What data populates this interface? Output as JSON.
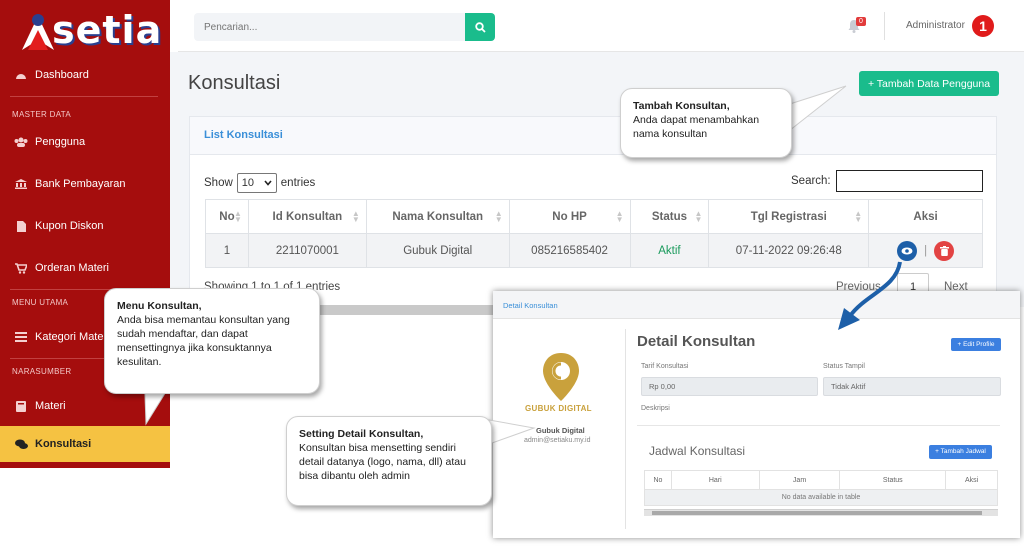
{
  "sidebar": {
    "logo_text": "setia",
    "items": [
      {
        "label": "Dashboard"
      },
      {
        "label": "Pengguna"
      },
      {
        "label": "Bank Pembayaran"
      },
      {
        "label": "Kupon Diskon"
      },
      {
        "label": "Orderan Materi"
      },
      {
        "label": "Kategori Materi"
      },
      {
        "label": "Materi"
      },
      {
        "label": "Konsultasi"
      }
    ],
    "sections": [
      "MASTER DATA",
      "MENU UTAMA",
      "NARASUMBER"
    ]
  },
  "topbar": {
    "search_placeholder": "Pencarian...",
    "notif_count": "0",
    "user_name": "Administrator",
    "avatar_letter": "1"
  },
  "main": {
    "page_title": "Konsultasi",
    "add_button": "+ Tambah Data Pengguna",
    "card_title": "List Konsultasi",
    "show_label": "Show",
    "show_value": "10",
    "entries_label": "entries",
    "search_label": "Search:",
    "table": {
      "headers": [
        "No",
        "Id Konsultan",
        "Nama Konsultan",
        "No HP",
        "Status",
        "Tgl Registrasi",
        "Aksi"
      ],
      "rows": [
        [
          "1",
          "2211070001",
          "Gubuk Digital",
          "085216585402",
          "Aktif",
          "07-11-2022 09:26:48"
        ]
      ]
    },
    "footer_info": "Showing 1 to 1 of 1 entries",
    "pager_prev": "Previous",
    "pager_page": "1",
    "pager_next": "Next"
  },
  "detail": {
    "breadcrumb": "Detail Konsultan",
    "brand": "GUBUK DIGITAL",
    "name": "Gubuk Digital",
    "email": "admin@setiaku.my.id",
    "title": "Detail Konsultan",
    "edit_button": "+ Edit Profile",
    "tarif_label": "Tarif Konsultasi",
    "tarif_value": "Rp 0,00",
    "status_label": "Status Tampil",
    "status_value": "Tidak Aktif",
    "deskripsi_label": "Deskripsi",
    "jadwal_title": "Jadwal Konsultasi",
    "jadwal_button": "+ Tambah Jadwal",
    "jadwal_headers": [
      "No",
      "Hari",
      "Jam",
      "Status",
      "Aksi"
    ],
    "jadwal_empty": "No data available in table"
  },
  "callouts": {
    "tambah": {
      "title": "Tambah Konsultan,",
      "body": "Anda dapat menambahkan nama konsultan"
    },
    "menu": {
      "title": "Menu Konsultan,",
      "body": "Anda bisa memantau konsultan yang sudah mendaftar, dan dapat mensettingnya jika konsuktannya kesulitan."
    },
    "setting": {
      "title": "Setting Detail Konsultan,",
      "body": "Konsultan bisa mensetting sendiri detail datanya (logo, nama, dll) atau bisa dibantu oleh admin"
    }
  },
  "colors": {
    "sidebar": "#a50d0d",
    "active": "#f5c242",
    "accent": "#1abc8c",
    "link": "#3a8fd8"
  },
  "icons": [
    "dashboard-icon",
    "users-icon",
    "bank-icon",
    "file-icon",
    "cart-icon",
    "list-icon",
    "book-icon",
    "chat-icon",
    "search-icon",
    "bell-icon",
    "eye-icon",
    "trash-icon"
  ]
}
